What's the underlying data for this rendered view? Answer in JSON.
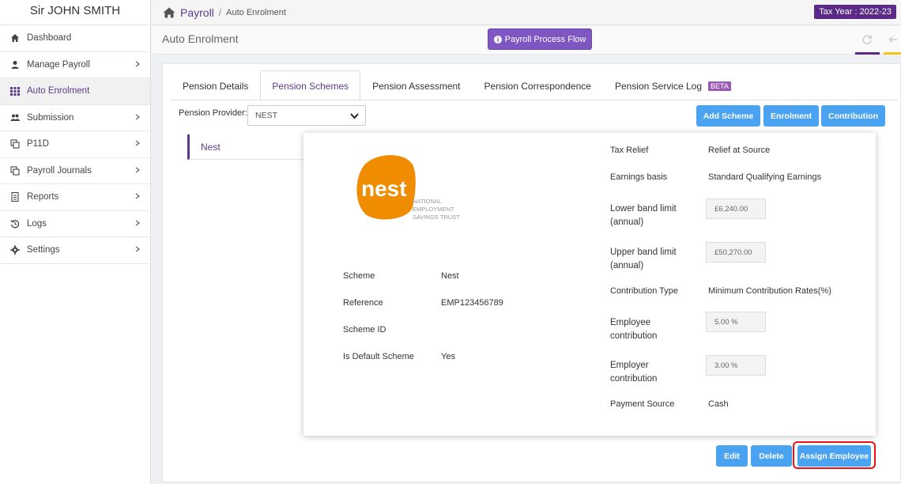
{
  "user": {
    "name": "Sir JOHN SMITH"
  },
  "sidebar": {
    "items": [
      {
        "label": "Dashboard",
        "icon": "dashboard-icon",
        "chevron": false
      },
      {
        "label": "Manage Payroll",
        "icon": "user-icon",
        "chevron": true
      },
      {
        "label": "Auto Enrolment",
        "icon": "grid-icon",
        "chevron": false,
        "active": true
      },
      {
        "label": "Submission",
        "icon": "users-icon",
        "chevron": true
      },
      {
        "label": "P11D",
        "icon": "copy-icon",
        "chevron": true
      },
      {
        "label": "Payroll Journals",
        "icon": "copy-icon",
        "chevron": true
      },
      {
        "label": "Reports",
        "icon": "report-icon",
        "chevron": true
      },
      {
        "label": "Logs",
        "icon": "history-icon",
        "chevron": true
      },
      {
        "label": "Settings",
        "icon": "gear-icon",
        "chevron": true
      }
    ]
  },
  "breadcrumb": {
    "main": "Payroll",
    "separator": "/",
    "sub": "Auto Enrolment"
  },
  "tax_year": "Tax Year : 2022-23",
  "page_title": "Auto Enrolment",
  "flow_button": "Payroll Process Flow",
  "tabs": [
    {
      "label": "Pension Details",
      "active": false
    },
    {
      "label": "Pension Schemes",
      "active": true
    },
    {
      "label": "Pension Assessment",
      "active": false
    },
    {
      "label": "Pension Correspondence",
      "active": false
    },
    {
      "label": "Pension Service Log",
      "active": false,
      "badge": "BETA"
    }
  ],
  "provider": {
    "label": "Pension Provider:",
    "selected": "NEST"
  },
  "actions": {
    "add_scheme": "Add Scheme",
    "enrolment": "Enrolment",
    "contribution": "Contribution"
  },
  "scheme_list": [
    "Nest"
  ],
  "logo": {
    "word": "nest",
    "line1": "NATIONAL",
    "line2": "EMPLOYMENT",
    "line3": "SAVINGS TRUST"
  },
  "details_left": {
    "scheme_label": "Scheme",
    "scheme_value": "Nest",
    "reference_label": "Reference",
    "reference_value": "EMP123456789",
    "scheme_id_label": "Scheme ID",
    "scheme_id_value": "",
    "default_label": "Is Default Scheme",
    "default_value": "Yes"
  },
  "details_right": {
    "tax_relief_label": "Tax Relief",
    "tax_relief_value": "Relief at Source",
    "earnings_label": "Earnings basis",
    "earnings_value": "Standard Qualifying Earnings",
    "lower_label_1": "Lower band limit",
    "lower_label_2": "(annual)",
    "lower_value": "£6,240.00",
    "upper_label_1": "Upper band limit",
    "upper_label_2": "(annual)",
    "upper_value": "£50,270.00",
    "contrib_type_label": "Contribution Type",
    "contrib_type_value": "Minimum Contribution Rates(%)",
    "employee_label_1": "Employee",
    "employee_label_2": "contribution",
    "employee_value": "5.00 %",
    "employer_label_1": "Employer",
    "employer_label_2": "contribution",
    "employer_value": "3.00 %",
    "payment_label": "Payment Source",
    "payment_value": "Cash"
  },
  "footer_buttons": {
    "edit": "Edit",
    "delete": "Delete",
    "assign": "Assign Employee"
  },
  "colors": {
    "brand_purple": "#5b2a86",
    "button_blue": "#4aa3f0",
    "nest_orange": "#f08c00",
    "highlight_red": "#e11"
  }
}
